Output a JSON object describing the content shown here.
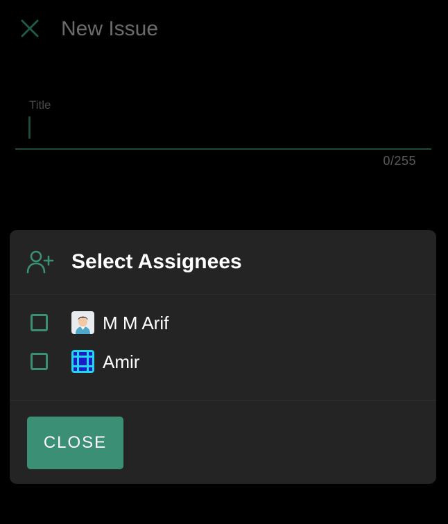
{
  "appbar": {
    "title": "New Issue",
    "close_icon": "close-icon"
  },
  "form": {
    "title_label": "Title",
    "title_value": "",
    "char_count": "0/255"
  },
  "dialog": {
    "icon": "add-person-icon",
    "title": "Select Assignees",
    "assignees": [
      {
        "name": "M M Arif",
        "checked": false,
        "avatar": "person-avatar"
      },
      {
        "name": "Amir",
        "checked": false,
        "avatar": "pattern-avatar"
      }
    ],
    "close_label": "CLOSE"
  },
  "colors": {
    "accent": "#3a8f74",
    "dialog_bg": "#242424",
    "background": "#000000"
  }
}
